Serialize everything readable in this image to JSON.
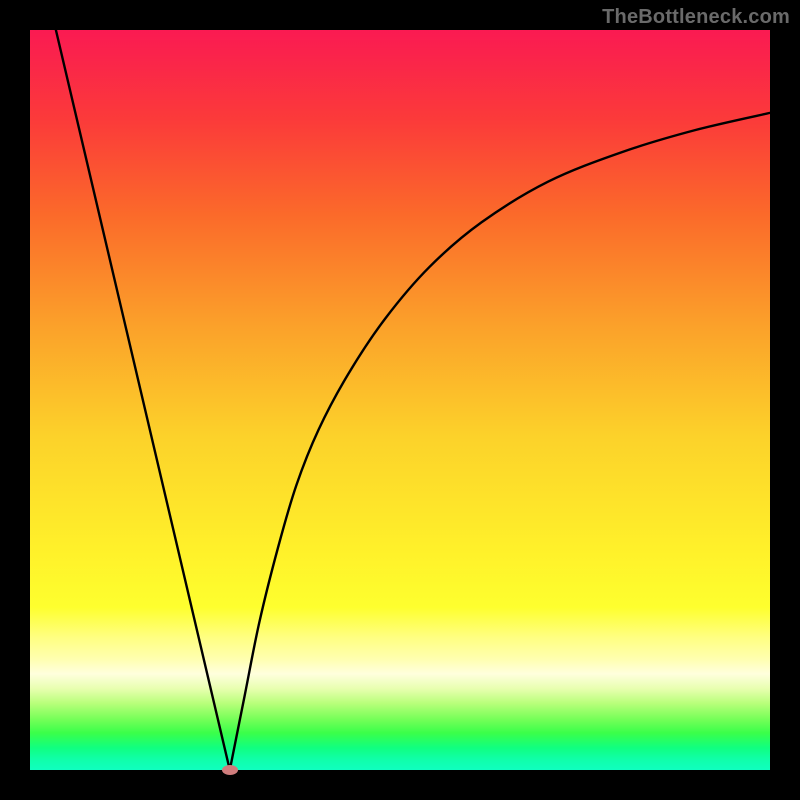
{
  "watermark": "TheBottleneck.com",
  "chart_data": {
    "type": "line",
    "title": "",
    "xlabel": "",
    "ylabel": "",
    "xlim": [
      0,
      100
    ],
    "ylim": [
      0,
      100
    ],
    "grid": false,
    "legend": false,
    "series": [
      {
        "name": "left-branch",
        "x": [
          3.5,
          27
        ],
        "y": [
          100,
          0
        ]
      },
      {
        "name": "right-branch",
        "x": [
          27,
          29,
          31,
          33.5,
          36,
          39,
          43,
          48,
          54,
          61,
          70,
          80,
          90,
          100
        ],
        "y": [
          0,
          10,
          20,
          30,
          38.5,
          46,
          53.5,
          61,
          68,
          74,
          79.5,
          83.5,
          86.5,
          88.8
        ]
      }
    ],
    "marker": {
      "x": 27,
      "y": 0,
      "color": "#cf7c7c"
    },
    "gradient_colors": [
      "#fa1a52",
      "#fba12a",
      "#fff02a",
      "#10ffc0"
    ]
  }
}
